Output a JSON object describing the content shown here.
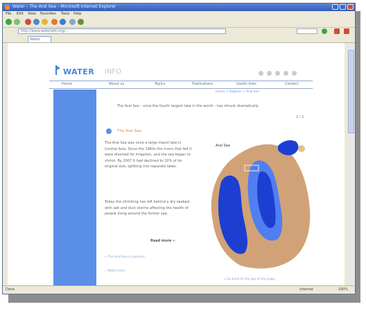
{
  "window": {
    "title": "Water – The Aral Sea – Microsoft Internet Explorer"
  },
  "menu": [
    "File",
    "Edit",
    "View",
    "Favorites",
    "Tools",
    "Help"
  ],
  "address": {
    "value": "http://www.waterwiki.org/..."
  },
  "tab": {
    "label": "Water"
  },
  "site": {
    "logo_main": "WATER",
    "logo_sub": "INFO"
  },
  "nav": [
    "Home",
    "About us",
    "Topics",
    "Publications",
    "Useful links",
    "Contact"
  ],
  "breadcrumb": "Home > Regions > Aral Sea",
  "intro": "The Aral Sea – once the fourth largest lake in the world – has shrunk dramatically.",
  "page_num": "1 / 2",
  "section": {
    "title": "The Aral Sea"
  },
  "paragraphs": [
    "The Aral Sea was once a large inland lake in Central Asia. Since the 1960s the rivers that fed it were diverted for irrigation, and the sea began to shrink. By 2007 it had declined to 10% of its original size, splitting into separate lakes.",
    "Today the shrinking has left behind a dry seabed, with salt and dust storms affecting the health of people living around the former sea."
  ],
  "more_link": "Read more »",
  "links": [
    "» The Aral Sea in pictures",
    "» Water links"
  ],
  "map": {
    "label": "Aral Sea"
  },
  "bottom_link": "» Go back to the top of the page",
  "status": {
    "left": "Done",
    "zone": "Internet",
    "zoom": "100%"
  },
  "colors": {
    "titlebar": "#2f5cb8",
    "sidebar": "#5b8ee6",
    "accent": "#e0892c",
    "water_deep": "#1c3fd1",
    "water_light": "#4f7ff0",
    "land": "#d1a278"
  }
}
